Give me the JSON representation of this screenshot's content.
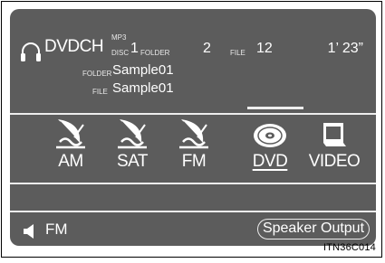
{
  "header": {
    "source": "DVDCH",
    "format": "MP3",
    "disc_label": "DISC",
    "disc_number": "1",
    "folder_label": "FOLDER",
    "folder_number": "2",
    "file_label": "FILE",
    "file_number": "12",
    "elapsed_time": "1’ 23”"
  },
  "track_info": {
    "folder_label": "FOLDER",
    "folder_name": "Sample01",
    "file_label": "FILE",
    "file_name": "Sample01"
  },
  "sources": [
    {
      "label": "AM",
      "icon": "satellite-antenna-icon"
    },
    {
      "label": "SAT",
      "icon": "satellite-antenna-icon"
    },
    {
      "label": "FM",
      "icon": "satellite-antenna-icon"
    },
    {
      "label": "DVD",
      "icon": "disc-icon",
      "selected": true
    },
    {
      "label": "VIDEO",
      "icon": "monitor-icon"
    }
  ],
  "footer": {
    "speaker_source": "FM",
    "speaker_output_button": "Speaker Output"
  },
  "caption": "ITN36C014",
  "colors": {
    "screen_bg": "#5c5c5c",
    "foreground": "#ffffff"
  }
}
